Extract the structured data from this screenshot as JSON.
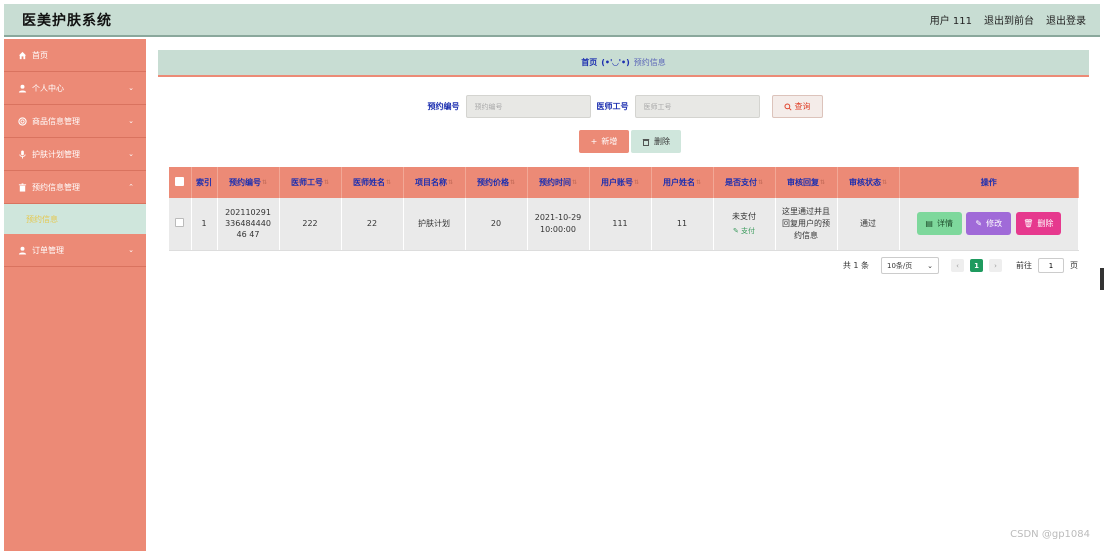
{
  "header": {
    "app_title": "医美护肤系统",
    "user_text": "用户 111",
    "back_to_front": "退出到前台",
    "logout": "退出登录"
  },
  "sidebar": {
    "items": [
      {
        "label": "首页",
        "icon": "home-icon"
      },
      {
        "label": "个人中心",
        "icon": "user-icon"
      },
      {
        "label": "商品信息管理",
        "icon": "lifebuoy-icon"
      },
      {
        "label": "护肤计划管理",
        "icon": "mic-icon"
      },
      {
        "label": "预约信息管理",
        "icon": "trash-icon"
      },
      {
        "label": "订单管理",
        "icon": "user-icon"
      }
    ],
    "subitem": "预约信息"
  },
  "breadcrumb": {
    "home": "首页",
    "separator": "(•'◡'•)",
    "current": "预约信息"
  },
  "search": {
    "label1": "预约编号",
    "placeholder1": "预约编号",
    "label2": "医师工号",
    "placeholder2": "医师工号",
    "query_button": "查询"
  },
  "actions": {
    "add": "新增",
    "delete": "删除"
  },
  "table": {
    "headers": [
      "索引",
      "预约编号",
      "医师工号",
      "医师姓名",
      "项目名称",
      "预约价格",
      "预约时间",
      "用户账号",
      "用户姓名",
      "是否支付",
      "审核回复",
      "审核状态",
      "操作"
    ],
    "rows": [
      {
        "index": "1",
        "booking_no": "20211029133648444046 47",
        "doctor_id": "222",
        "doctor_name": "22",
        "project": "护肤计划",
        "price": "20",
        "time": "2021-10-29 10:00:00",
        "user_account": "111",
        "user_name": "11",
        "paid": "未支付",
        "pay_link": "支付",
        "reply": "这里通过并且回复用户的预约信息",
        "status": "通过",
        "btn_detail": "详情",
        "btn_edit": "修改",
        "btn_remove": "删除"
      }
    ]
  },
  "pagination": {
    "total": "共 1 条",
    "page_size": "10条/页",
    "current_page": "1",
    "goto_label": "前往",
    "goto_value": "1",
    "page_unit": "页"
  },
  "watermark": "CSDN @gp1084"
}
